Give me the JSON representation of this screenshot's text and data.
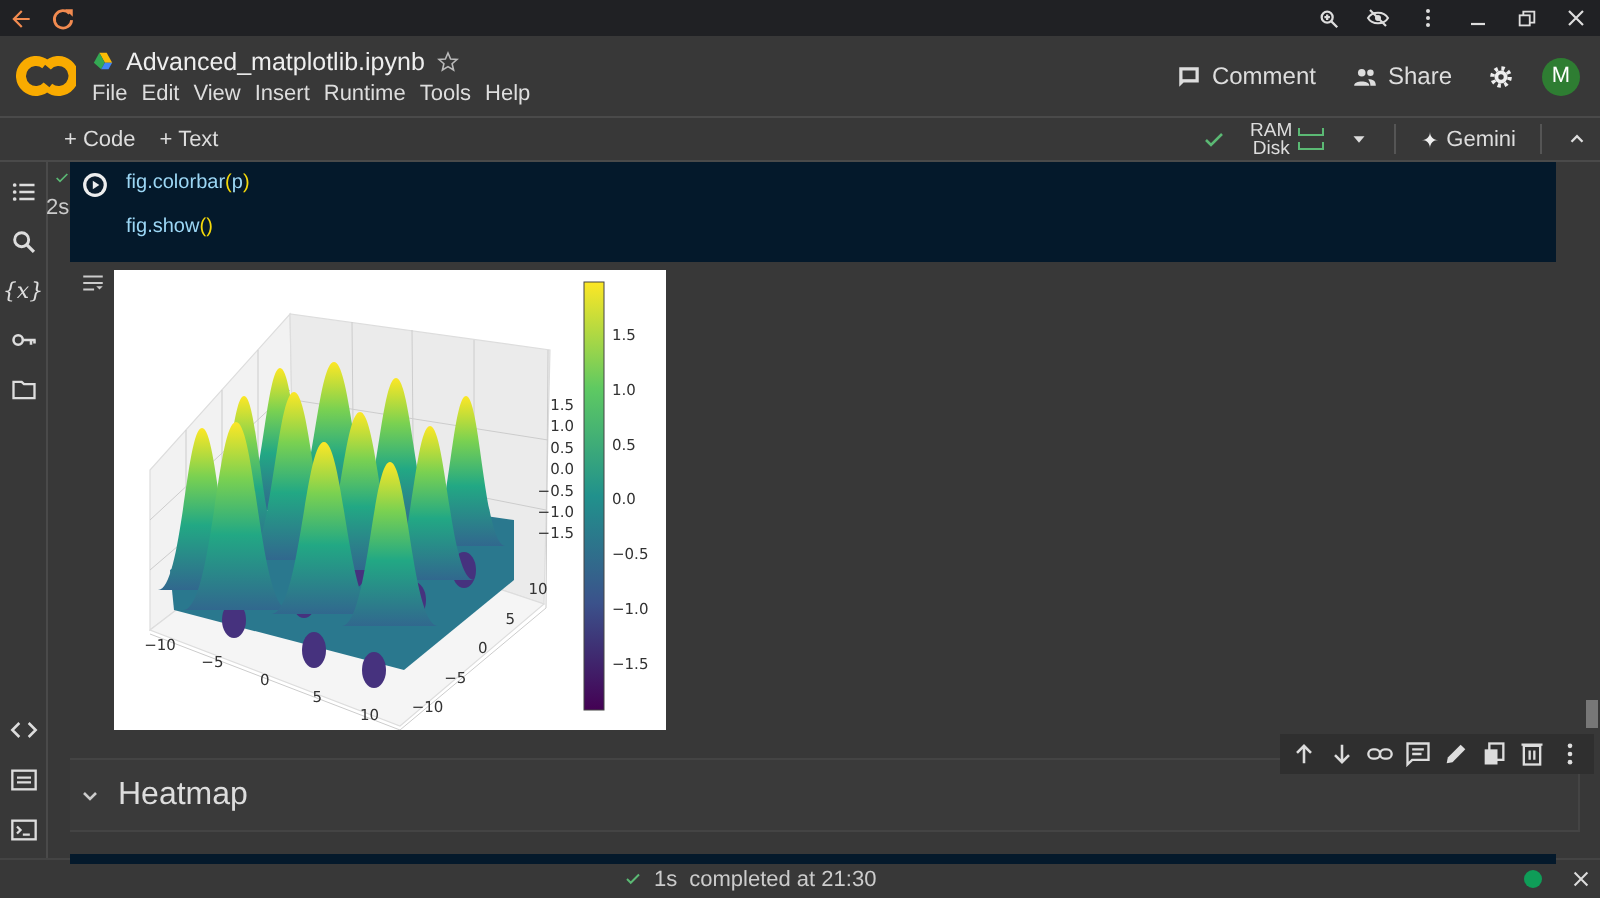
{
  "notebook": {
    "title": "Advanced_matplotlib.ipynb",
    "starred": false
  },
  "menu": [
    "File",
    "Edit",
    "View",
    "Insert",
    "Runtime",
    "Tools",
    "Help"
  ],
  "header_actions": {
    "comment": "Comment",
    "share": "Share",
    "avatar": "M"
  },
  "toolbar": {
    "add_buttons": [
      "+ Code",
      "+ Text"
    ],
    "resources": [
      "RAM",
      "Disk"
    ],
    "connected": true,
    "gemini": "Gemini"
  },
  "sidebar": {
    "variables_label": "{x}"
  },
  "code_cell": {
    "exec_time": "2s",
    "succeeded": true,
    "lines": [
      "fig.colorbar(p)",
      "fig.show()"
    ]
  },
  "plot": {
    "z_ticks": [
      "1.5",
      "1.0",
      "0.5",
      "0.0",
      "−0.5",
      "−1.0",
      "−1.5"
    ],
    "x_ticks": [
      "−10",
      "−5",
      "0",
      "5",
      "10"
    ],
    "y_ticks": [
      "10",
      "5",
      "0",
      "−5",
      "−10"
    ],
    "colorbar_ticks": [
      "1.5",
      "1.0",
      "0.5",
      "0.0",
      "−0.5",
      "−1.0",
      "−1.5"
    ]
  },
  "section": {
    "title": "Heatmap",
    "expanded": true
  },
  "status_bar": {
    "succeeded": true,
    "duration": "1s",
    "message": "completed at 21:30",
    "connected": true
  }
}
